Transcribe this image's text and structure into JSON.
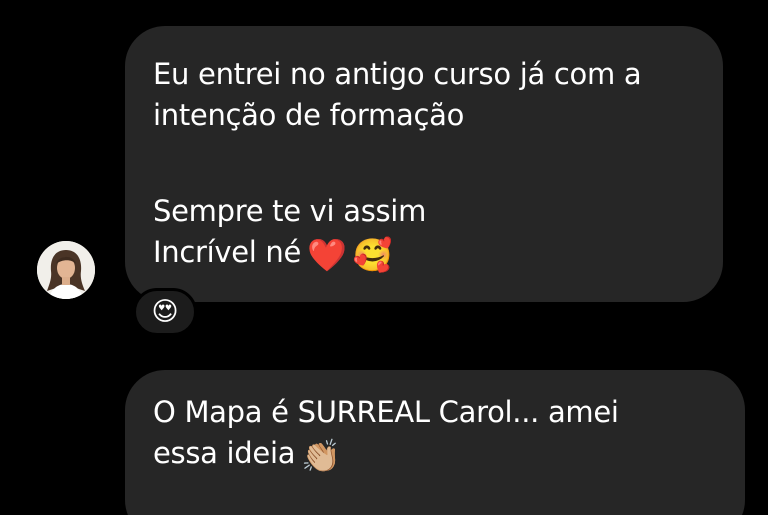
{
  "messages": [
    {
      "lines": [
        "Eu entrei no antigo curso já com a",
        "intenção de formação",
        "",
        "Sempre te vi assim",
        "Incrível né"
      ],
      "trailing_emojis": [
        "❤️",
        "🥰"
      ],
      "reaction": "😍"
    },
    {
      "lines": [
        "O Mapa é SURREAL Carol... amei",
        "essa ideia"
      ],
      "trailing_emojis": [
        "👏🏼"
      ]
    }
  ],
  "colors": {
    "background": "#000000",
    "bubble": "#262626",
    "text": "#ffffff"
  },
  "icons": {
    "avatar": "sender-profile-photo"
  }
}
